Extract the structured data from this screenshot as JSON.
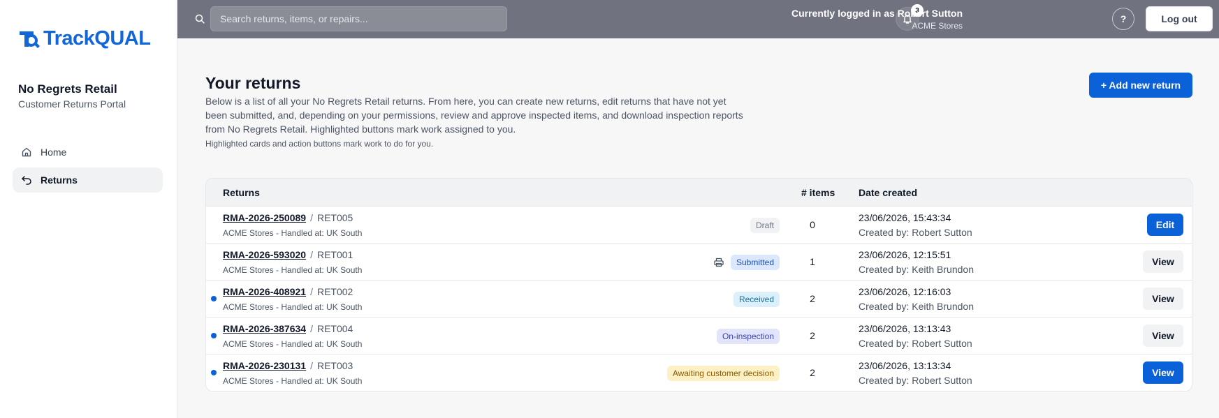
{
  "brand": {
    "name": "TrackQUAL",
    "accent": "#1167d8"
  },
  "sidebar": {
    "org_name": "No Regrets Retail",
    "org_sub": "Customer Returns Portal",
    "items": [
      {
        "label": "Home",
        "icon": "home-icon",
        "active": false
      },
      {
        "label": "Returns",
        "icon": "return-arrow-icon",
        "active": true
      }
    ]
  },
  "topbar": {
    "search_placeholder": "Search returns, items, or repairs...",
    "notifications_count": "3",
    "user_line": "Currently logged in as Robert Sutton",
    "user_org": "ACME Stores",
    "help_label": "?",
    "logout_label": "Log out"
  },
  "main": {
    "title": "Your returns",
    "description": "Below is a list of all your No Regrets Retail returns. From here, you can create new returns, edit returns that have not yet been submitted, and, depending on your permissions, review and approve inspected items, and download inspection reports from No Regrets Retail. Highlighted buttons mark work assigned to you.",
    "hint": "Highlighted cards and action buttons mark work to do for you.",
    "add_button": "+ Add new return"
  },
  "table": {
    "columns": {
      "returns": "Returns",
      "items": "# items",
      "date": "Date created"
    },
    "rows": [
      {
        "rma": "RMA-2026-250089",
        "ret": "RET005",
        "sub": "ACME Stores - Handled at: UK South",
        "status": "Draft",
        "status_bg": "#f1f2f4",
        "status_fg": "#6b7280",
        "printable": false,
        "items": "0",
        "date": "23/06/2026, 15:43:34",
        "creator": "Created by: Robert Sutton",
        "action": "Edit",
        "action_primary": true,
        "highlight": false
      },
      {
        "rma": "RMA-2026-593020",
        "ret": "RET001",
        "sub": "ACME Stores - Handled at: UK South",
        "status": "Submitted",
        "status_bg": "#dbe7fb",
        "status_fg": "#1e4fae",
        "printable": true,
        "items": "1",
        "date": "23/06/2026, 12:15:51",
        "creator": "Created by: Keith Brundon",
        "action": "View",
        "action_primary": false,
        "highlight": false
      },
      {
        "rma": "RMA-2026-408921",
        "ret": "RET002",
        "sub": "ACME Stores - Handled at: UK South",
        "status": "Received",
        "status_bg": "#dcf0fb",
        "status_fg": "#1a6d96",
        "printable": false,
        "items": "2",
        "date": "23/06/2026, 12:16:03",
        "creator": "Created by: Keith Brundon",
        "action": "View",
        "action_primary": false,
        "highlight": true
      },
      {
        "rma": "RMA-2026-387634",
        "ret": "RET004",
        "sub": "ACME Stores - Handled at: UK South",
        "status": "On-inspection",
        "status_bg": "#e2e4fb",
        "status_fg": "#3c46a8",
        "printable": false,
        "items": "2",
        "date": "23/06/2026, 13:13:43",
        "creator": "Created by: Robert Sutton",
        "action": "View",
        "action_primary": false,
        "highlight": true
      },
      {
        "rma": "RMA-2026-230131",
        "ret": "RET003",
        "sub": "ACME Stores - Handled at: UK South",
        "status": "Awaiting customer decision",
        "status_bg": "#fdf0c4",
        "status_fg": "#8a5a00",
        "printable": false,
        "items": "2",
        "date": "23/06/2026, 13:13:34",
        "creator": "Created by: Robert Sutton",
        "action": "View",
        "action_primary": true,
        "highlight": true
      }
    ]
  }
}
